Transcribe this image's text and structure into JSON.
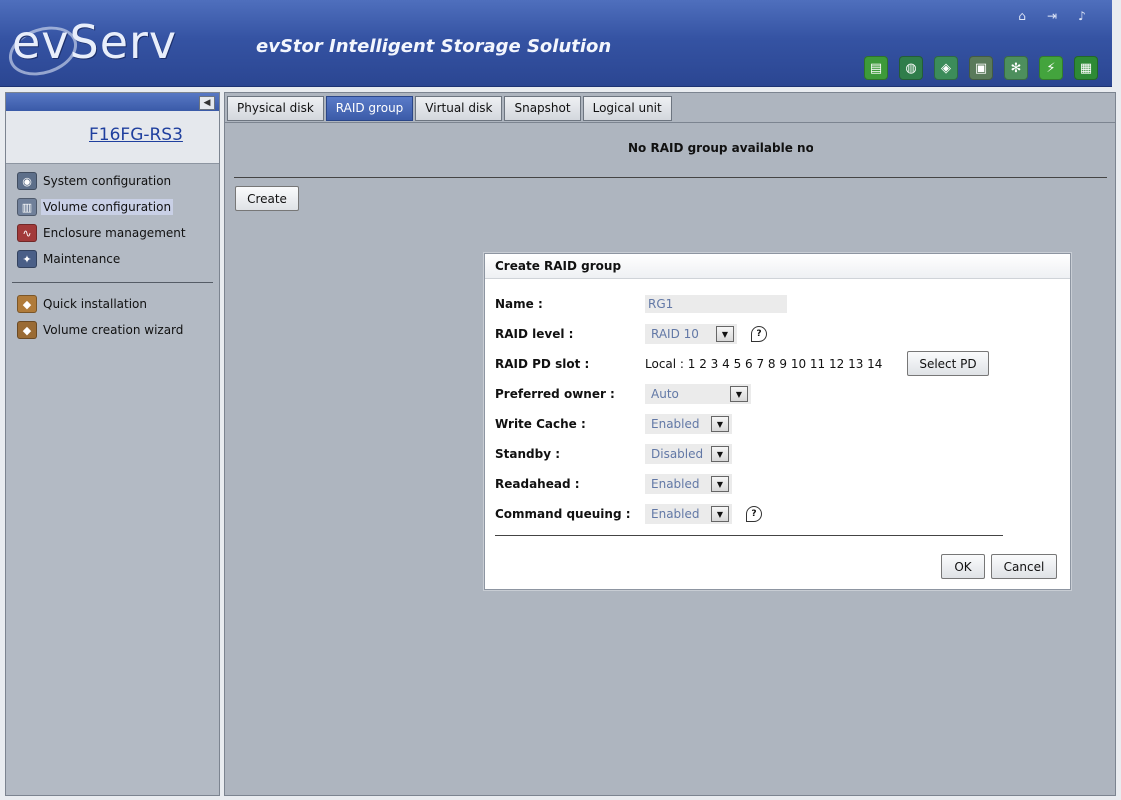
{
  "header": {
    "logo_text": "evServ",
    "tagline": "evStor Intelligent Storage Solution",
    "top_icons": [
      {
        "name": "home-icon",
        "glyph": "⌂"
      },
      {
        "name": "logout-icon",
        "glyph": "⇥"
      },
      {
        "name": "sound-icon",
        "glyph": "♪"
      }
    ],
    "tool_icons": [
      {
        "name": "storage-icon",
        "glyph": "▤",
        "color": "#3d9a3a"
      },
      {
        "name": "temperature-icon",
        "glyph": "◍",
        "color": "#2f7d4a"
      },
      {
        "name": "network-icon",
        "glyph": "◈",
        "color": "#3c8c5a"
      },
      {
        "name": "disk-icon",
        "glyph": "▣",
        "color": "#5a7a5a"
      },
      {
        "name": "fan-icon",
        "glyph": "✻",
        "color": "#4d8f5d"
      },
      {
        "name": "power-icon",
        "glyph": "⚡",
        "color": "#43a43d"
      },
      {
        "name": "module-icon",
        "glyph": "▦",
        "color": "#2e8a36"
      }
    ]
  },
  "sidebar": {
    "device_name": "F16FG-RS3",
    "nav_main": [
      {
        "label": "System configuration",
        "icon": "camera-icon",
        "glyph": "◉",
        "color": "#5d6f8a",
        "active": false
      },
      {
        "label": "Volume configuration",
        "icon": "volume-icon",
        "glyph": "▥",
        "color": "#70809a",
        "active": true
      },
      {
        "label": "Enclosure management",
        "icon": "enclosure-icon",
        "glyph": "∿",
        "color": "#a23a3a",
        "active": false
      },
      {
        "label": "Maintenance",
        "icon": "maintenance-icon",
        "glyph": "✦",
        "color": "#4a5f87",
        "active": false
      }
    ],
    "nav_wizard": [
      {
        "label": "Quick installation",
        "icon": "quick-install-icon",
        "glyph": "◆",
        "color": "#b07b3a"
      },
      {
        "label": "Volume creation wizard",
        "icon": "wizard-icon",
        "glyph": "◆",
        "color": "#9a6b34"
      }
    ]
  },
  "main": {
    "tabs": [
      {
        "label": "Physical disk",
        "active": false
      },
      {
        "label": "RAID group",
        "active": true
      },
      {
        "label": "Virtual disk",
        "active": false
      },
      {
        "label": "Snapshot",
        "active": false
      },
      {
        "label": "Logical unit",
        "active": false
      }
    ],
    "empty_message": "No RAID group available no",
    "create_label": "Create"
  },
  "dialog": {
    "title": "Create RAID group",
    "name_label": "Name :",
    "name_value": "RG1",
    "raid_level_label": "RAID level :",
    "raid_level_value": "RAID 10",
    "pd_slot_label": "RAID PD slot :",
    "pd_slot_value": "Local : 1 2 3 4 5 6 7 8 9 10 11 12 13 14",
    "select_pd_label": "Select PD",
    "owner_label": "Preferred owner :",
    "owner_value": "Auto",
    "write_cache_label": "Write Cache :",
    "write_cache_value": "Enabled",
    "standby_label": "Standby :",
    "standby_value": "Disabled",
    "readahead_label": "Readahead :",
    "readahead_value": "Enabled",
    "cmd_queue_label": "Command queuing :",
    "cmd_queue_value": "Enabled",
    "ok_label": "OK",
    "cancel_label": "Cancel"
  }
}
